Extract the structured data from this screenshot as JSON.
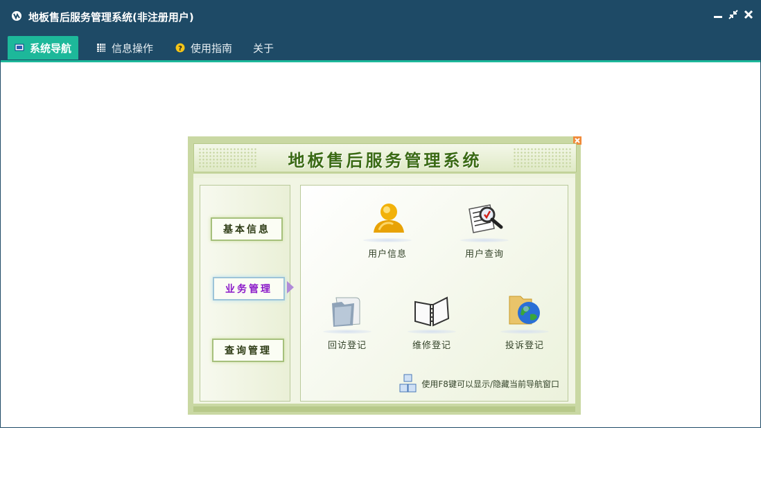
{
  "window": {
    "title": "地板售后服务管理系统(非注册用户)"
  },
  "menu": {
    "items": [
      {
        "label": "系统导航",
        "icon": "monitor-icon",
        "active": true
      },
      {
        "label": "信息操作",
        "icon": "grid-icon",
        "active": false
      },
      {
        "label": "使用指南",
        "icon": "help-icon",
        "active": false
      },
      {
        "label": "关于",
        "icon": "",
        "active": false
      }
    ]
  },
  "nav": {
    "title": "地板售后服务管理系统",
    "left_buttons": [
      {
        "label": "基本信息"
      },
      {
        "label": "业务管理",
        "selected": true
      },
      {
        "label": "查询管理"
      }
    ],
    "functions": [
      {
        "label": "用户信息",
        "icon": "user-icon"
      },
      {
        "label": "用户查询",
        "icon": "search-document-icon"
      },
      {
        "label": "回访登记",
        "icon": "folder-document-icon"
      },
      {
        "label": "维修登记",
        "icon": "notebook-icon"
      },
      {
        "label": "投诉登记",
        "icon": "globe-folder-icon"
      }
    ],
    "hint": "使用F8键可以显示/隐藏当前导航窗口"
  },
  "colors": {
    "titlebar": "#1e4a66",
    "accent": "#1db89a",
    "nav_green": "#3a6a14",
    "selected_text": "#8a18c8"
  }
}
